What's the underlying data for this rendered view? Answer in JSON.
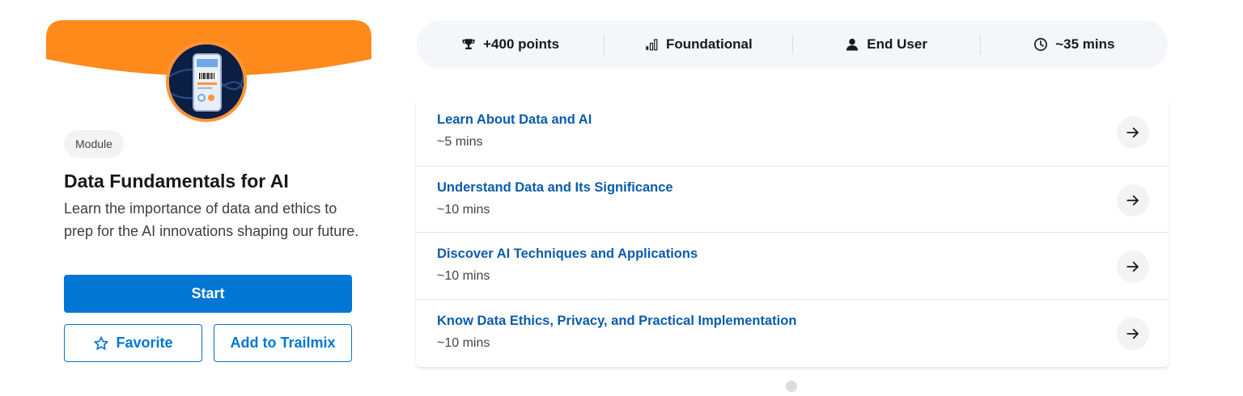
{
  "module": {
    "type_label": "Module",
    "title": "Data Fundamentals for AI",
    "description": "Learn the importance of data and ethics to prep for the AI innovations shaping our future.",
    "badge_icon": "phone-barcode-badge-icon",
    "start_label": "Start",
    "favorite_label": "Favorite",
    "trailmix_label": "Add to Trailmix"
  },
  "stats": [
    {
      "icon": "trophy-icon",
      "label": "+400 points"
    },
    {
      "icon": "signal-bars-icon",
      "label": "Foundational"
    },
    {
      "icon": "user-icon",
      "label": "End User"
    },
    {
      "icon": "clock-icon",
      "label": "~35 mins"
    }
  ],
  "units": [
    {
      "title": "Learn About Data and AI",
      "time": "~5 mins"
    },
    {
      "title": "Understand Data and Its Significance",
      "time": "~10 mins"
    },
    {
      "title": "Discover AI Techniques and Applications",
      "time": "~10 mins"
    },
    {
      "title": "Know Data Ethics, Privacy, and Practical Implementation",
      "time": "~10 mins"
    }
  ],
  "colors": {
    "brand_blue": "#0176d3",
    "link_blue": "#0b5cab",
    "banner_orange": "#fe8a1c",
    "badge_navy": "#0b1f44"
  }
}
